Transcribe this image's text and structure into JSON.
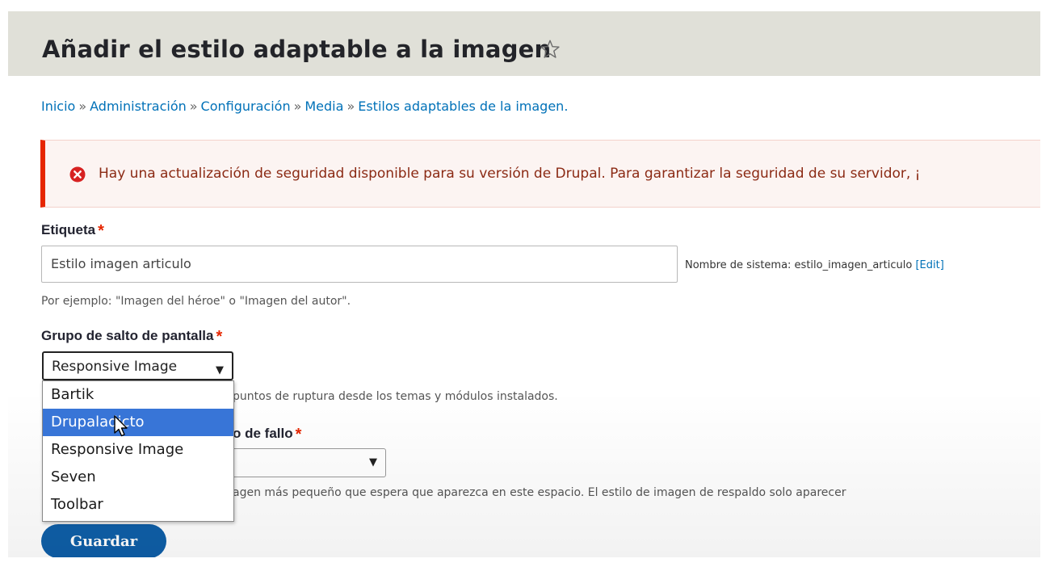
{
  "header": {
    "title": "Añadir el estilo adaptable a la imagen"
  },
  "breadcrumb": {
    "items": [
      "Inicio",
      "Administración",
      "Configuración",
      "Media"
    ],
    "separator": "»",
    "current": "Estilos adaptables de la imagen."
  },
  "alert": {
    "type": "error",
    "text": "Hay una actualización de seguridad disponible para su versión de Drupal. Para garantizar la seguridad de su servidor, ¡"
  },
  "form": {
    "label_field": {
      "label": "Etiqueta",
      "value": "Estilo imagen articulo",
      "machine_name_prefix": "Nombre de sistema: estilo_imagen_articulo",
      "machine_name_edit": "[Edit]",
      "description": "Por ejemplo: \"Imagen del héroe\" o \"Imagen del autor\"."
    },
    "breakpoint_group": {
      "label": "Grupo de salto de pantalla",
      "selected": "Responsive Image",
      "description_visible": "puntos de ruptura desde los temas y módulos instalados.",
      "options": [
        "Bartik",
        "Drupaladicto",
        "Responsive Image",
        "Seven",
        "Toolbar"
      ],
      "highlighted_option": "Drupaladicto"
    },
    "fallback_style": {
      "label_visible": "o de fallo",
      "selected": "",
      "description_visible": "agen más pequeño que espera que aparezca en este espacio. El estilo de imagen de respaldo solo aparecer"
    },
    "required_marker": "*",
    "save_label": "Guardar"
  },
  "colors": {
    "link": "#0071b8",
    "error": "#e62600",
    "primary_button": "#0f5fa8",
    "highlight": "#3875d7",
    "title_bar": "#e0e0d8"
  }
}
